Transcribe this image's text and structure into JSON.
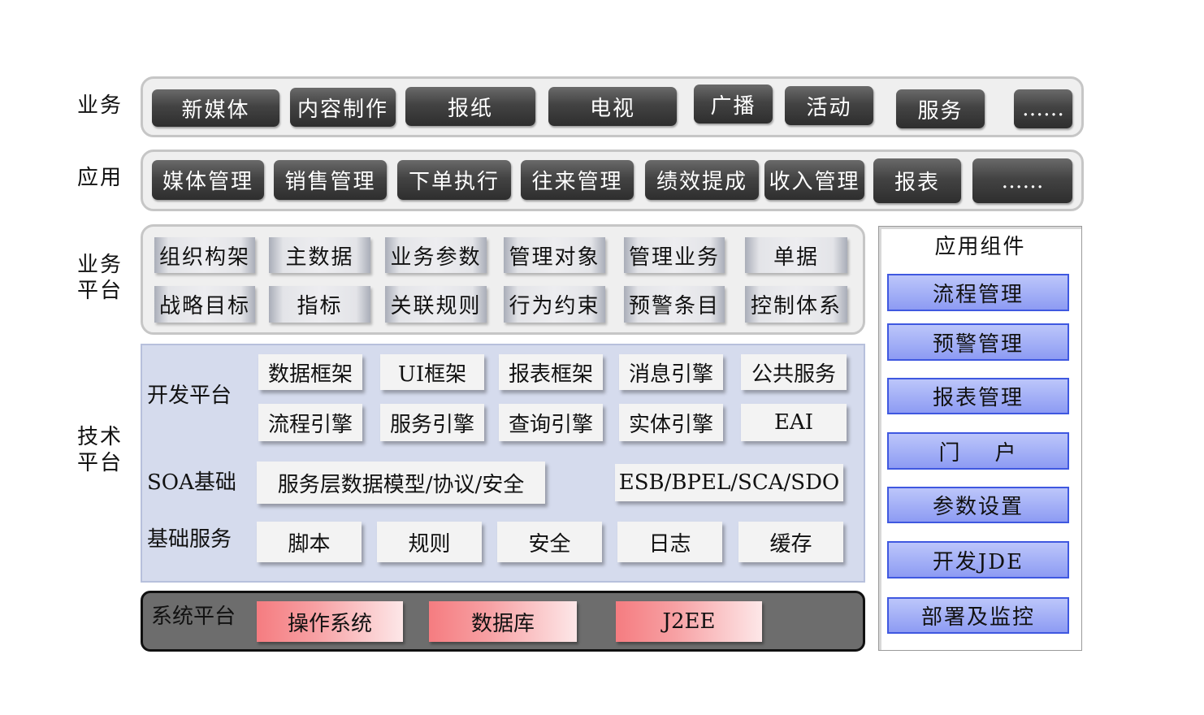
{
  "rows": {
    "business": "业务",
    "application": "应用",
    "business_platform": "业务\n平台",
    "tech_platform": "技术\n平台"
  },
  "business_items": [
    "新媒体",
    "内容制作",
    "报纸",
    "电视",
    "广播",
    "活动",
    "服务",
    "……"
  ],
  "application_items": [
    "媒体管理",
    "销售管理",
    "下单执行",
    "往来管理",
    "绩效提成",
    "收入管理",
    "报表",
    "……"
  ],
  "business_platform": {
    "row1": [
      "组织构架",
      "主数据",
      "业务参数",
      "管理对象",
      "管理业务",
      "单据"
    ],
    "row2": [
      "战略目标",
      "指标",
      "关联规则",
      "行为约束",
      "预警条目",
      "控制体系"
    ]
  },
  "tech_platform": {
    "dev_label": "开发平台",
    "dev_row1": [
      "数据框架",
      "UI框架",
      "报表框架",
      "消息引擎",
      "公共服务"
    ],
    "dev_row2": [
      "流程引擎",
      "服务引擎",
      "查询引擎",
      "实体引擎",
      "EAI"
    ],
    "soa_label": "SOA基础",
    "soa_items": [
      "服务层数据模型/协议/安全",
      "ESB/BPEL/SCA/SDO"
    ],
    "base_label": "基础服务",
    "base_items": [
      "脚本",
      "规则",
      "安全",
      "日志",
      "缓存"
    ]
  },
  "system_platform": {
    "label": "系统平台",
    "items": [
      "操作系统",
      "数据库",
      "J2EE"
    ]
  },
  "components": {
    "title": "应用组件",
    "items": [
      "流程管理",
      "预警管理",
      "报表管理",
      "门    户",
      "参数设置",
      "开发JDE",
      "部署及监控"
    ]
  }
}
